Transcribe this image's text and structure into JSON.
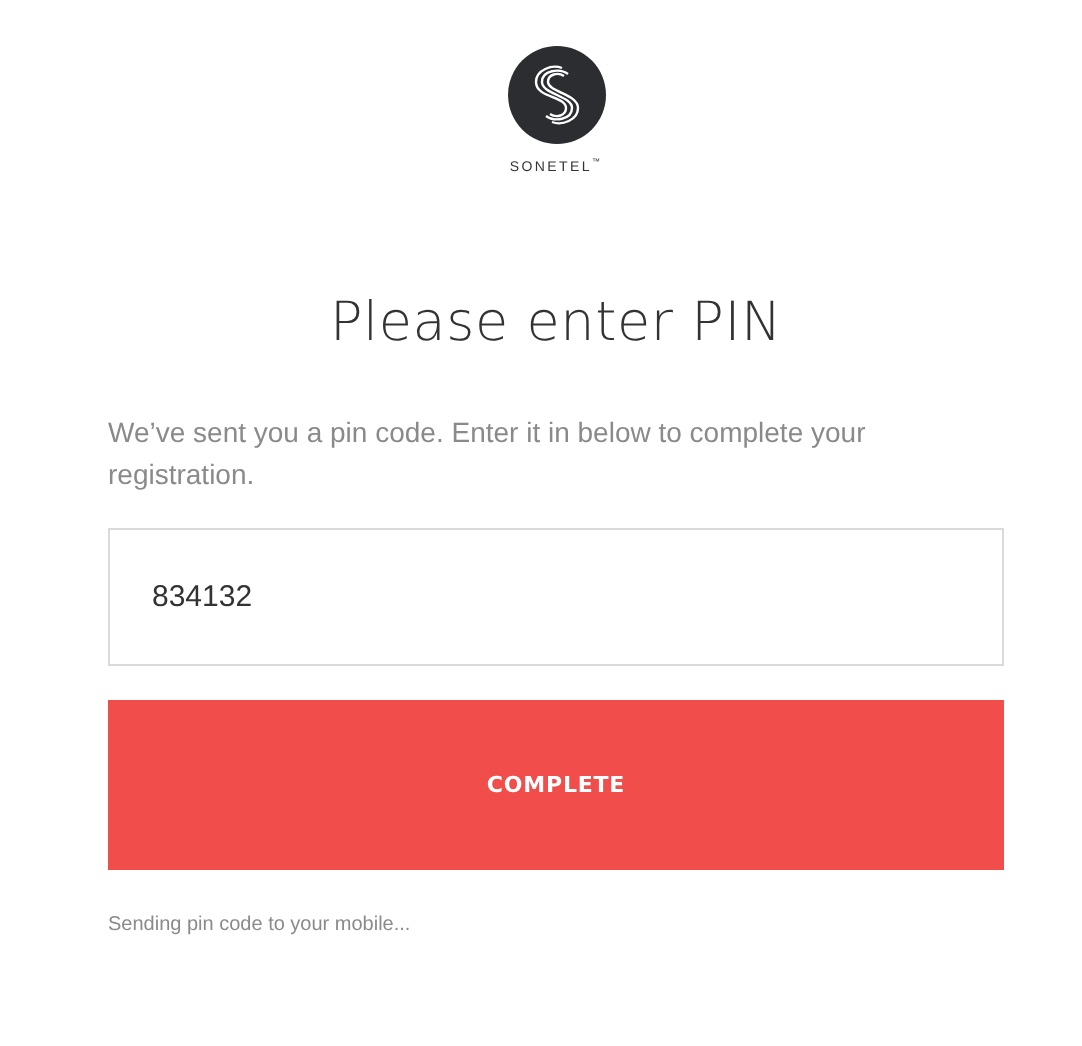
{
  "logo": {
    "brand": "SONETEL$^{™}$"
  },
  "heading": "Please enter PIN",
  "message": "We’ve sent you a pin code. Enter it in below to complete your registration.",
  "pin_field": {
    "value": "834132"
  },
  "button": {
    "label": "COMPLETE"
  },
  "status": "Sending pin code to your mobile..."
}
